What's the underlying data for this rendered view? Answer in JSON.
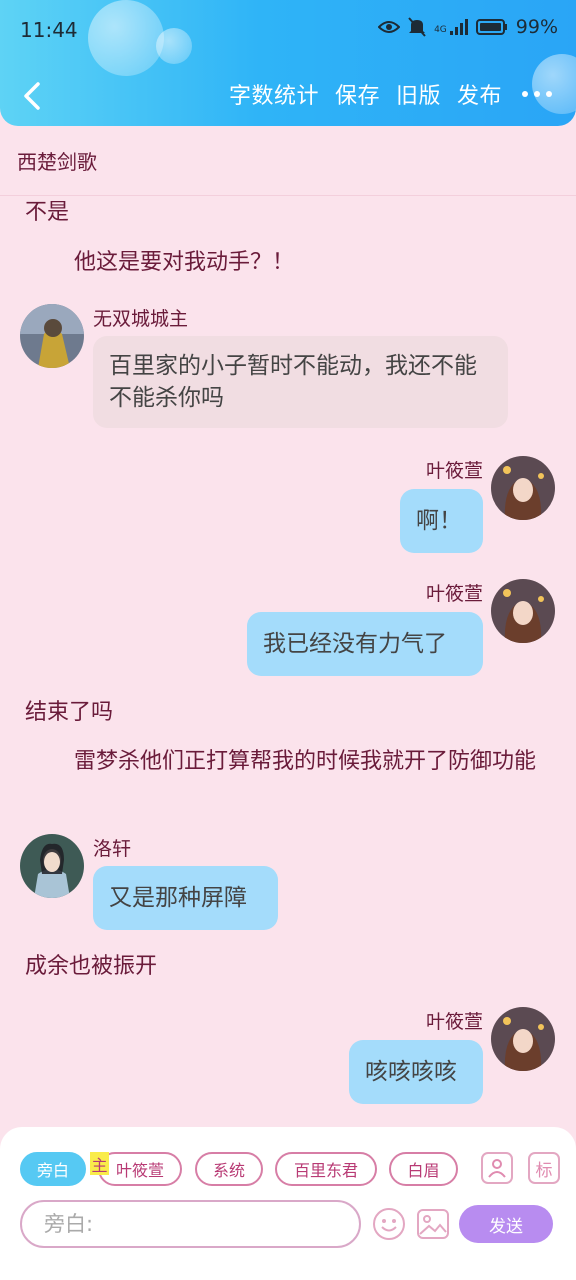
{
  "status_bar": {
    "time": "11:44",
    "network": "4G",
    "battery": "99%"
  },
  "toolbar": {
    "actions": [
      "字数统计",
      "保存",
      "旧版",
      "发布"
    ]
  },
  "story": {
    "title": "西楚剑歌"
  },
  "messages": [
    {
      "type": "narration",
      "text": "不是"
    },
    {
      "type": "narration",
      "text": "他这是要对我动手？！"
    },
    {
      "type": "chat",
      "side": "left",
      "sender": "无双城城主",
      "text": "百里家的小子暂时不能动，我还不能不能杀你吗"
    },
    {
      "type": "chat",
      "side": "right",
      "sender": "叶筱萱",
      "text": "啊！"
    },
    {
      "type": "chat",
      "side": "right",
      "sender": "叶筱萱",
      "text": "我已经没有力气了"
    },
    {
      "type": "narration",
      "text": "结束了吗"
    },
    {
      "type": "narration",
      "text": "雷梦杀他们正打算帮我的时候我就开了防御功能"
    },
    {
      "type": "chat",
      "side": "left",
      "sender": "洛轩",
      "text": "又是那种屏障"
    },
    {
      "type": "narration",
      "text": "成余也被振开"
    },
    {
      "type": "chat",
      "side": "right",
      "sender": "叶筱萱",
      "text": "咳咳咳咳"
    }
  ],
  "role_bar": {
    "roles": [
      "旁白",
      "叶筱萱",
      "系统",
      "百里东君",
      "白眉"
    ],
    "main_tag": "主",
    "label_button": "标"
  },
  "composer": {
    "placeholder": "旁白:",
    "send_label": "发送"
  },
  "colors": {
    "header_start": "#5ed3f5",
    "header_end": "#2aa5f6",
    "background": "#fbe3ec",
    "accent_text": "#6a1b3a",
    "send": "#b88cf0"
  }
}
